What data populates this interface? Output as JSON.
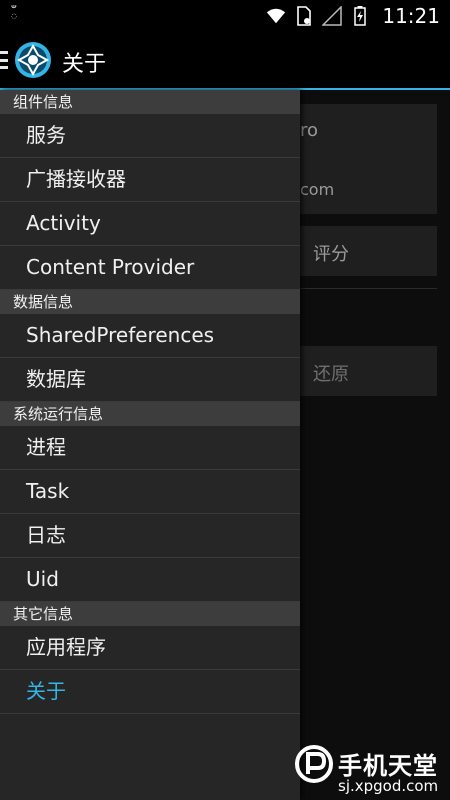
{
  "status_bar": {
    "time": "11:21",
    "icons": [
      "notification-icon",
      "wifi-icon",
      "sim-icon",
      "signal-icon",
      "battery-icon"
    ]
  },
  "action_bar": {
    "title": "关于",
    "icons": [
      "menu-icon",
      "app-logo-icon"
    ]
  },
  "background": {
    "card1_text1": "ro",
    "card1_text2": "com",
    "card2_text": "评分",
    "card3_text": "还原"
  },
  "drawer": {
    "sections": [
      {
        "header": "组件信息",
        "items": [
          "服务",
          "广播接收器",
          "Activity",
          "Content Provider"
        ]
      },
      {
        "header": "数据信息",
        "items": [
          "SharedPreferences",
          "数据库"
        ]
      },
      {
        "header": "系统运行信息",
        "items": [
          "进程",
          "Task",
          "日志",
          "Uid"
        ]
      },
      {
        "header": "其它信息",
        "items": [
          "应用程序",
          "关于"
        ]
      }
    ],
    "selected_item": "关于",
    "accent_color": "#33b5e5"
  },
  "watermark": {
    "name": "手机天堂",
    "url": "sj.xpgod.com"
  }
}
